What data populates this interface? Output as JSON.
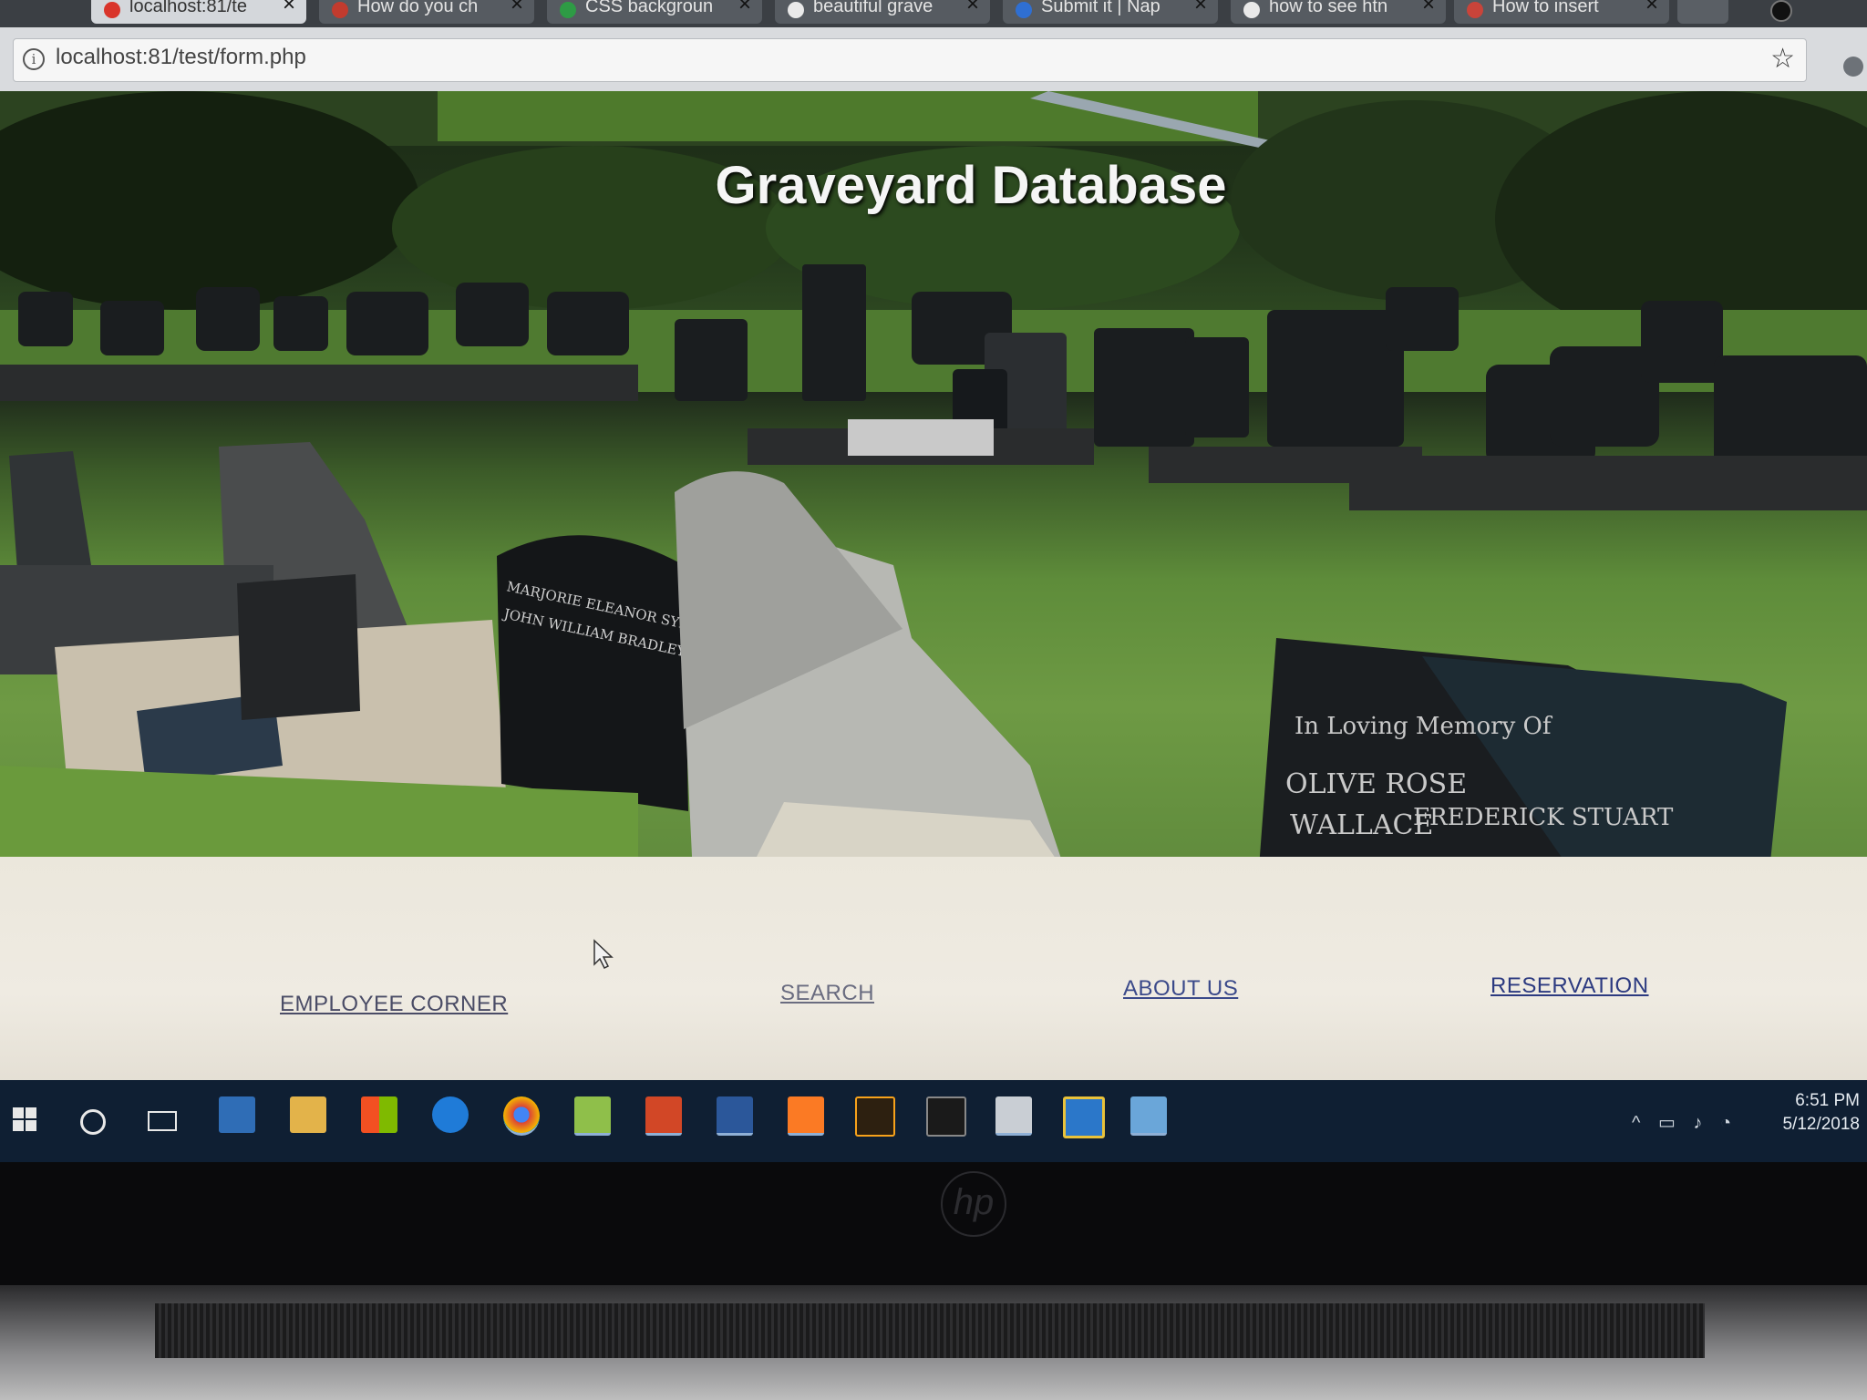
{
  "browser": {
    "tabs": [
      {
        "title": "localhost:81/te",
        "favicon_color": "#d9352b",
        "active": true
      },
      {
        "title": "How do you ch",
        "favicon_color": "#c23b2e",
        "active": false
      },
      {
        "title": "CSS backgroun",
        "favicon_color": "#2e9b45",
        "active": false
      },
      {
        "title": "beautiful grave",
        "favicon_color": "#e9e9e9",
        "active": false
      },
      {
        "title": "Submit it | Nap",
        "favicon_color": "#2f6fd2",
        "active": false
      },
      {
        "title": "how to see htn",
        "favicon_color": "#e9e9e9",
        "active": false
      },
      {
        "title": "How to insert",
        "favicon_color": "#c9443a",
        "active": false
      }
    ],
    "url": "localhost:81/test/form.php"
  },
  "page": {
    "title": "Graveyard Database",
    "nav": [
      {
        "label": "EMPLOYEE CORNER",
        "color": "#4a4c66"
      },
      {
        "label": "SEARCH",
        "color": "#6a6c80"
      },
      {
        "label": "ABOUT US",
        "color": "#3b4a8a"
      },
      {
        "label": "RESERVATION",
        "color": "#2c3a80"
      }
    ],
    "headstone_text": {
      "front_left": [
        "MARJORIE ELEANOR SYKES",
        "JOHN WILLIAM BRADLEY SYKES"
      ],
      "front_right": [
        "In Loving Memory Of",
        "OLIVE ROSE",
        "WALLACE",
        "FREDERICK STUART"
      ]
    }
  },
  "taskbar": {
    "apps": [
      "cortana-icon",
      "file-explorer-icon",
      "store-icon",
      "edge-icon",
      "chrome-icon",
      "notepad-plus-icon",
      "powerpoint-icon",
      "word-icon",
      "xampp-icon",
      "illustrator-icon",
      "terminal-icon",
      "photos-icon",
      "virtualbox-icon",
      "image-viewer-icon"
    ],
    "time": "6:51 PM",
    "date": "5/12/2018"
  },
  "device": {
    "logo": "hp"
  }
}
